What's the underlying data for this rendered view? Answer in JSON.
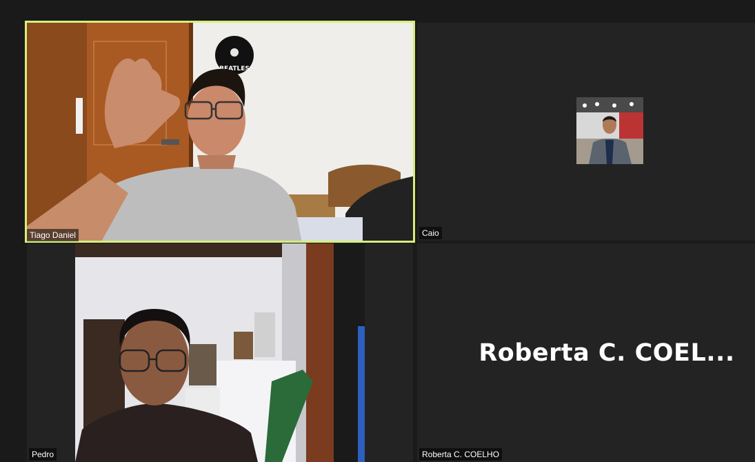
{
  "participants": [
    {
      "name": "Tiago Daniel",
      "video": "on",
      "active_speaker": true
    },
    {
      "name": "Caio",
      "video": "thumbnail"
    },
    {
      "name": "Pedro",
      "video": "on"
    },
    {
      "name": "Roberta C. COELHO",
      "video": "off",
      "display_name": "Roberta C. COEL..."
    }
  ],
  "colors": {
    "background": "#1a1a1a",
    "tile": "#232323",
    "active_speaker_border": "#d6ef7c"
  },
  "decor": {
    "record_label": "BEATLES"
  }
}
